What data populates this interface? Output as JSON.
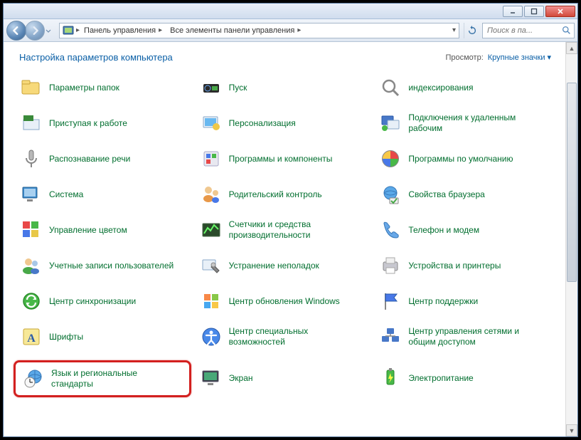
{
  "breadcrumb": {
    "segments": [
      "Панель управления",
      "Все элементы панели управления"
    ]
  },
  "search": {
    "placeholder": "Поиск в па..."
  },
  "header": {
    "title": "Настройка параметров компьютера",
    "view_label": "Просмотр:",
    "view_value": "Крупные значки"
  },
  "items": {
    "col1": [
      {
        "name": "item-folder-options",
        "icon": "folder-icon",
        "label": "Параметры папок"
      },
      {
        "name": "item-getting-started",
        "icon": "flag-icon",
        "label": "Приступая к работе"
      },
      {
        "name": "item-speech-recognition",
        "icon": "microphone-icon",
        "label": "Распознавание речи"
      },
      {
        "name": "item-system",
        "icon": "system-icon",
        "label": "Система"
      },
      {
        "name": "item-color-management",
        "icon": "color-icon",
        "label": "Управление цветом"
      },
      {
        "name": "item-user-accounts",
        "icon": "users-icon",
        "label": "Учетные записи пользователей"
      },
      {
        "name": "item-sync-center",
        "icon": "sync-icon",
        "label": "Центр синхронизации"
      },
      {
        "name": "item-fonts",
        "icon": "fonts-icon",
        "label": "Шрифты"
      },
      {
        "name": "item-region-language",
        "icon": "globe-clock-icon",
        "label": "Язык и региональные стандарты",
        "highlighted": true
      }
    ],
    "col2": [
      {
        "name": "item-start",
        "icon": "start-icon",
        "label": "Пуск"
      },
      {
        "name": "item-personalization",
        "icon": "personalization-icon",
        "label": "Персонализация"
      },
      {
        "name": "item-programs-features",
        "icon": "programs-icon",
        "label": "Программы и компоненты"
      },
      {
        "name": "item-parental-controls",
        "icon": "parental-icon",
        "label": "Родительский контроль"
      },
      {
        "name": "item-performance",
        "icon": "performance-icon",
        "label": "Счетчики и средства производительности"
      },
      {
        "name": "item-troubleshooting",
        "icon": "troubleshoot-icon",
        "label": "Устранение неполадок"
      },
      {
        "name": "item-windows-update",
        "icon": "windows-update-icon",
        "label": "Центр обновления Windows"
      },
      {
        "name": "item-ease-of-access",
        "icon": "accessibility-icon",
        "label": "Центр специальных возможностей"
      },
      {
        "name": "item-display",
        "icon": "display-icon",
        "label": "Экран"
      }
    ],
    "col3": [
      {
        "name": "item-indexing",
        "icon": "indexing-icon",
        "label": "индексирования"
      },
      {
        "name": "item-remote-desktop",
        "icon": "remote-icon",
        "label": "Подключения к удаленным рабочим"
      },
      {
        "name": "item-default-programs",
        "icon": "defaults-icon",
        "label": "Программы по умолчанию"
      },
      {
        "name": "item-internet-options",
        "icon": "internet-icon",
        "label": "Свойства браузера"
      },
      {
        "name": "item-phone-modem",
        "icon": "phone-icon",
        "label": "Телефон и модем"
      },
      {
        "name": "item-devices-printers",
        "icon": "printer-icon",
        "label": "Устройства и принтеры"
      },
      {
        "name": "item-action-center",
        "icon": "flag2-icon",
        "label": "Центр поддержки"
      },
      {
        "name": "item-network-sharing",
        "icon": "network-icon",
        "label": "Центр управления сетями и общим доступом"
      },
      {
        "name": "item-power-options",
        "icon": "power-icon",
        "label": "Электропитание"
      }
    ]
  }
}
